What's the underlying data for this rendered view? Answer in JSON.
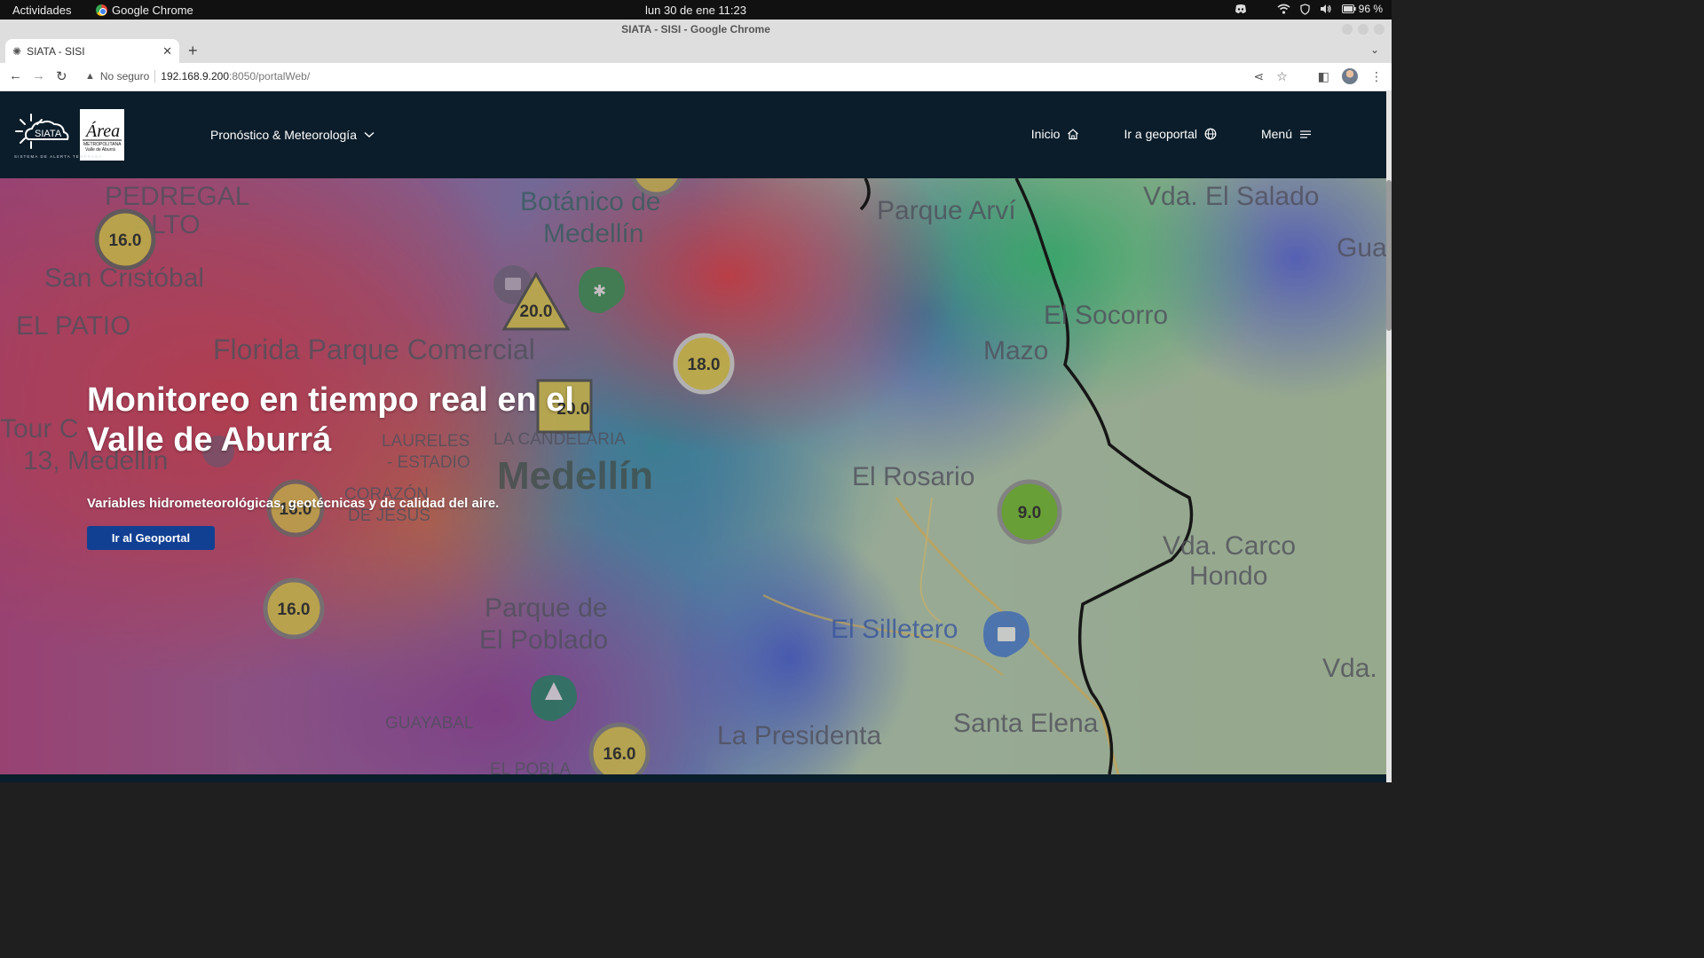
{
  "os": {
    "activities": "Actividades",
    "app_name": "Google Chrome",
    "clock": "lun 30 de ene  11:23",
    "battery": "96 %"
  },
  "browser": {
    "window_title": "SIATA - SISI - Google Chrome",
    "tab_title": "SIATA - SISI",
    "security_label": "No seguro",
    "url_host": "192.168.9.200",
    "url_path": ":8050/portalWeb/"
  },
  "site": {
    "nav_forecast": "Pronóstico & Meteorología",
    "nav_home": "Inicio",
    "nav_geoportal": "Ir a geoportal",
    "nav_menu": "Menú",
    "logo_siata": "SIATA",
    "logo_amva": "Área",
    "logo_amva_sub1": "METROPOLITANA",
    "logo_amva_sub2": "Valle de Aburrá",
    "logo_tagline": "SISTEMA DE ALERTA TEMPRANA"
  },
  "hero": {
    "title": "Monitoreo en tiempo real en el Valle de Aburrá",
    "subtitle": "Variables hidrometeorológicas, geotécnicas y de calidad del aire.",
    "button": "Ir al Geoportal"
  },
  "map_labels": [
    {
      "text": "PEDREGAL"
    },
    {
      "text": "ALTO"
    },
    {
      "text": "San Cristóbal"
    },
    {
      "text": "EL PATIO"
    },
    {
      "text": "Botánico de"
    },
    {
      "text": "Medellín"
    },
    {
      "text": "Florida Parque Comercial"
    },
    {
      "text": "Tour C"
    },
    {
      "text": "13, Medellín"
    },
    {
      "text": "LAURELES"
    },
    {
      "text": "- ESTADIO"
    },
    {
      "text": "LA CANDELARIA"
    },
    {
      "text": "Medellín"
    },
    {
      "text": "CORAZÓN"
    },
    {
      "text": "DE JESÚS"
    },
    {
      "text": "Parque de"
    },
    {
      "text": "El Poblado"
    },
    {
      "text": "GUAYABAL"
    },
    {
      "text": "EL POBLA"
    },
    {
      "text": "La Presidenta"
    },
    {
      "text": "Parque Arví"
    },
    {
      "text": "Vda. El Salado"
    },
    {
      "text": "Gua"
    },
    {
      "text": "El Socorro"
    },
    {
      "text": "Mazo"
    },
    {
      "text": "El Rosario"
    },
    {
      "text": "Vda. Carco"
    },
    {
      "text": "Hondo"
    },
    {
      "text": "El Silletero"
    },
    {
      "text": "Santa Elena"
    },
    {
      "text": "Vda."
    }
  ],
  "map_markers": [
    {
      "value": "16.0"
    },
    {
      "value": "20.0"
    },
    {
      "value": "18.0"
    },
    {
      "value": "20.0"
    },
    {
      "value": "16.0"
    },
    {
      "value": "16.0"
    },
    {
      "value": "16.0"
    },
    {
      "value": "9.0"
    }
  ]
}
